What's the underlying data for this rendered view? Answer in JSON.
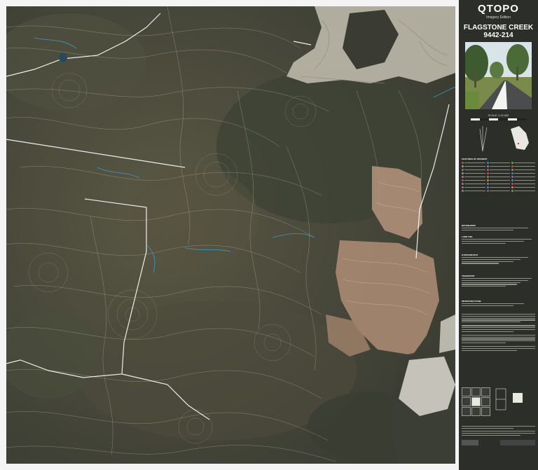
{
  "map_title": {
    "brand": "QTOPO",
    "edition": "Imagery Edition",
    "sheet_name": "FLAGSTONE CREEK",
    "sheet_number": "9442-214"
  },
  "scale": {
    "label": "SCALE 1:15,000"
  },
  "legend": {
    "sections": [
      "FEATURES OF INTEREST",
      "BOUNDARIES",
      "LAND USE",
      "HYDROGRAPHY",
      "TRANSPORT",
      "INFRASTRUCTURE"
    ]
  },
  "colors": {
    "panel_bg": "#2c2e2a",
    "map_bg": "#4a4a3a",
    "contour": "#d8d0b8",
    "water": "#3aa6d8",
    "road": "#ffffff",
    "cleared_land": "#b09078",
    "suburb": "#c8c4b8",
    "queensland_map": "#e8e8e0"
  }
}
